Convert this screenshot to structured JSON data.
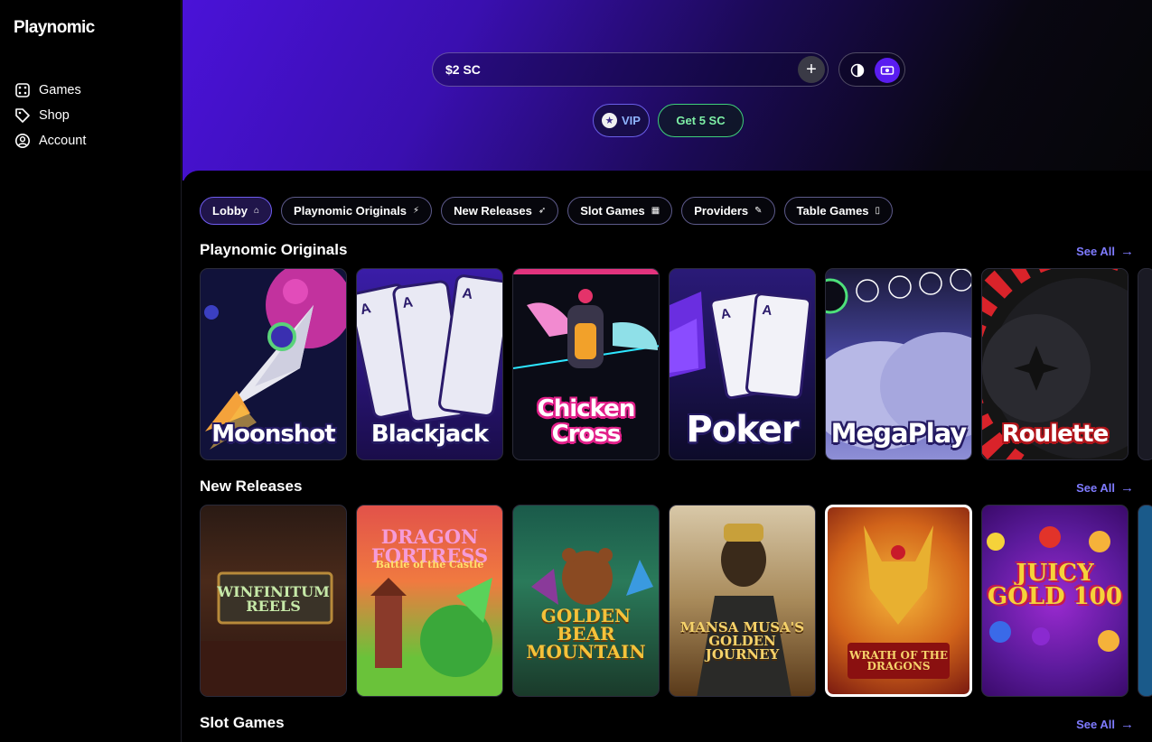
{
  "sidebar": {
    "logo": "Playnomic",
    "items": [
      {
        "label": "Games",
        "icon": "dice-icon"
      },
      {
        "label": "Shop",
        "icon": "tag-icon"
      },
      {
        "label": "Account",
        "icon": "user-circle-icon"
      }
    ]
  },
  "header": {
    "balance": "$2 SC",
    "vip_label": "VIP",
    "get_sc_label": "Get 5 SC"
  },
  "chips": [
    {
      "label": "Lobby",
      "icon": "home-icon"
    },
    {
      "label": "Playnomic Originals",
      "icon": "bolt-icon"
    },
    {
      "label": "New Releases",
      "icon": "rocket-icon"
    },
    {
      "label": "Slot Games",
      "icon": "slots-icon"
    },
    {
      "label": "Providers",
      "icon": "pen-icon"
    },
    {
      "label": "Table Games",
      "icon": "card-icon"
    }
  ],
  "sections": {
    "originals": {
      "title": "Playnomic Originals",
      "see_all": "See All",
      "games": [
        "Moonshot",
        "Blackjack",
        "Chicken Cross",
        "Poker",
        "MegaPlay",
        "Roulette"
      ]
    },
    "new_releases": {
      "title": "New Releases",
      "see_all": "See All",
      "games": [
        "WINFINITUM REELS",
        "DRAGON FORTRESS",
        "GOLDEN BEAR MOUNTAIN",
        "MANSA MUSA'S GOLDEN JOURNEY",
        "WRATH OF THE DRAGONS",
        "JUICY GOLD 100"
      ],
      "game_sublines": {
        "dragon_fortress": "Battle of the Castle"
      }
    },
    "slot_games": {
      "title": "Slot Games",
      "see_all": "See All"
    }
  },
  "colors": {
    "accent": "#5a1df0",
    "link": "#7f7bff",
    "green": "#3fcf7a"
  }
}
